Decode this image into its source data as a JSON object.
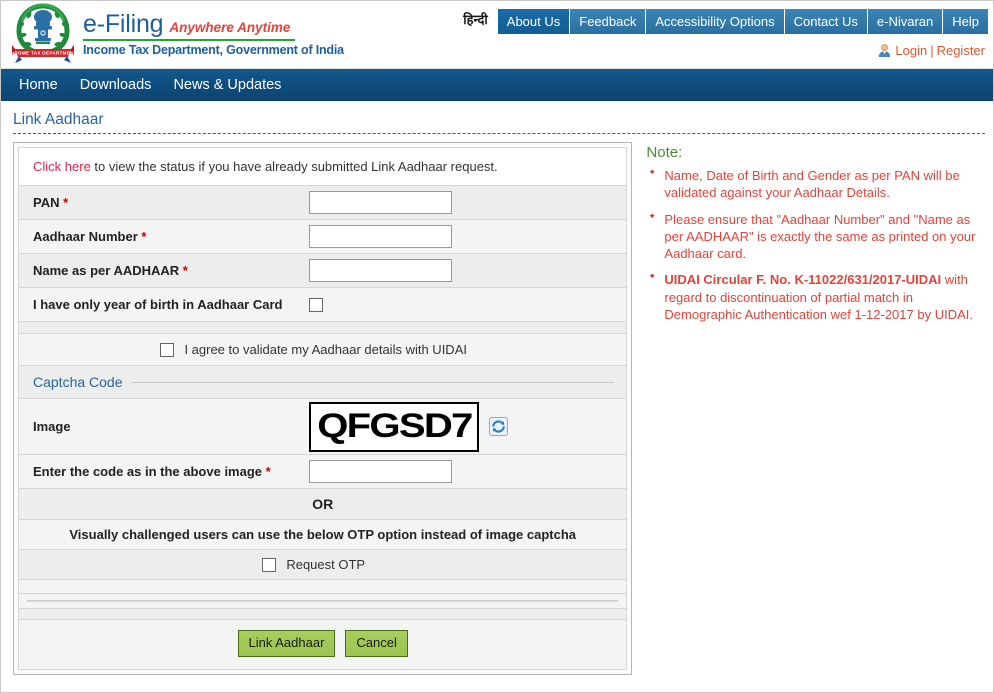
{
  "header": {
    "brand_title": "e-Filing",
    "brand_tagline": "Anywhere Anytime",
    "brand_subtitle": "Income Tax Department, Government of India",
    "emblem_icon": "national-emblem-icon",
    "hindi_label": "हिन्दी",
    "top_tabs": [
      {
        "label": "About Us",
        "active": true
      },
      {
        "label": "Feedback",
        "active": false
      },
      {
        "label": "Accessibility Options",
        "active": false
      },
      {
        "label": "Contact Us",
        "active": false
      },
      {
        "label": "e-Nivaran",
        "active": false
      },
      {
        "label": "Help",
        "active": false
      }
    ],
    "user_icon": "user-avatar-icon",
    "login_label": "Login",
    "login_separator": "|",
    "register_label": "Register"
  },
  "main_nav": {
    "items": [
      {
        "label": "Home"
      },
      {
        "label": "Downloads"
      },
      {
        "label": "News & Updates"
      }
    ]
  },
  "page": {
    "title": "Link Aadhaar"
  },
  "form": {
    "status_link_label": "Click here",
    "status_text": " to view the status if you have already submitted Link Aadhaar request.",
    "rows": [
      {
        "label": "PAN ",
        "required": "*",
        "value": "",
        "type": "text"
      },
      {
        "label": "Aadhaar Number ",
        "required": "*",
        "value": "",
        "type": "text"
      },
      {
        "label": "Name as per AADHAAR ",
        "required": "*",
        "value": "",
        "type": "text"
      },
      {
        "label": "I have only year of birth in Aadhaar Card",
        "required": "",
        "value": "",
        "type": "checkbox"
      }
    ],
    "agree_label": "I agree to validate my Aadhaar details with UIDAI",
    "agree_checked": false,
    "captcha_section_title": "Captcha Code",
    "captcha_image_label": "Image",
    "captcha_text": "QFGSD7",
    "refresh_icon": "refresh-captcha-icon",
    "captcha_input_label": "Enter the code as in the above image ",
    "captcha_input_required": "*",
    "captcha_input_value": "",
    "or_label": "OR",
    "otp_hint": "Visually challenged users can use the below OTP option instead of image captcha",
    "otp_label": "Request OTP",
    "otp_checked": false,
    "submit_label": "Link Aadhaar",
    "cancel_label": "Cancel"
  },
  "note": {
    "title": "Note:",
    "items": [
      {
        "bold_prefix": "",
        "text": "Name, Date of Birth and Gender as per PAN will be validated against your Aadhaar Details."
      },
      {
        "bold_prefix": "",
        "text": "Please ensure that \"Aadhaar Number\" and \"Name as per AADHAAR\" is exactly the same as printed on your Aadhaar card."
      },
      {
        "bold_prefix": "UIDAI Circular F. No. K-11022/631/2017-UIDAI ",
        "text": "with regard to discontinuation of partial match in Demographic Authentication wef 1-12-2017 by UIDAI."
      }
    ]
  },
  "colors": {
    "brand_blue": "#1f5f9c",
    "nav_blue": "#0b4370",
    "tab_blue": "#2a6f9f",
    "tab_active_blue": "#125f94",
    "accent_red": "#e0443a",
    "link_red": "#d6294a",
    "login_orange": "#e4562f",
    "note_green": "#4f8a3d",
    "button_green": "#9cc44f",
    "rule_green": "#2aa23a"
  }
}
